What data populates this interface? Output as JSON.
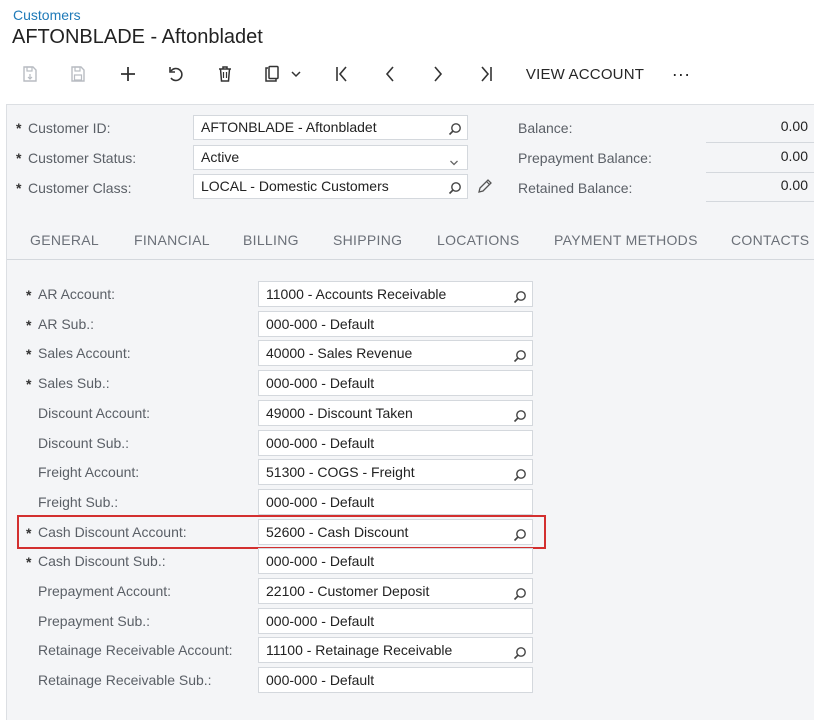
{
  "breadcrumb": "Customers",
  "title": "AFTONBLADE - Aftonbladet",
  "toolbar": {
    "view_account": "VIEW ACCOUNT",
    "more": "···"
  },
  "summary": {
    "customer_id": {
      "label": "Customer ID:",
      "value": "AFTONBLADE - Aftonbladet"
    },
    "customer_status": {
      "label": "Customer Status:",
      "value": "Active"
    },
    "customer_class": {
      "label": "Customer Class:",
      "value": "LOCAL - Domestic Customers"
    },
    "balance": {
      "label": "Balance:",
      "value": "0.00"
    },
    "prepayment_balance": {
      "label": "Prepayment Balance:",
      "value": "0.00"
    },
    "retained_balance": {
      "label": "Retained Balance:",
      "value": "0.00"
    }
  },
  "tabs": [
    "GENERAL",
    "FINANCIAL",
    "BILLING",
    "SHIPPING",
    "LOCATIONS",
    "PAYMENT METHODS",
    "CONTACTS"
  ],
  "accounts": [
    {
      "label": "AR Account:",
      "value": "11000 - Accounts Receivable",
      "required": "*",
      "lookup": true
    },
    {
      "label": "AR Sub.:",
      "value": "000-000 - Default",
      "required": "*",
      "lookup": false
    },
    {
      "label": "Sales Account:",
      "value": "40000 - Sales Revenue",
      "required": "*",
      "lookup": true
    },
    {
      "label": "Sales Sub.:",
      "value": "000-000 - Default",
      "required": "*",
      "lookup": false
    },
    {
      "label": "Discount Account:",
      "value": "49000 - Discount Taken",
      "required": "",
      "lookup": true
    },
    {
      "label": "Discount Sub.:",
      "value": "000-000 - Default",
      "required": "",
      "lookup": false
    },
    {
      "label": "Freight Account:",
      "value": "51300 - COGS - Freight",
      "required": "",
      "lookup": true
    },
    {
      "label": "Freight Sub.:",
      "value": "000-000 - Default",
      "required": "",
      "lookup": false
    },
    {
      "label": "Cash Discount Account:",
      "value": "52600 - Cash Discount",
      "required": "*",
      "lookup": true
    },
    {
      "label": "Cash Discount Sub.:",
      "value": "000-000 - Default",
      "required": "*",
      "lookup": false
    },
    {
      "label": "Prepayment Account:",
      "value": "22100 - Customer Deposit",
      "required": "",
      "lookup": true
    },
    {
      "label": "Prepayment Sub.:",
      "value": "000-000 - Default",
      "required": "",
      "lookup": false
    },
    {
      "label": "Retainage Receivable Account:",
      "value": "11100 - Retainage Receivable",
      "required": "",
      "lookup": true
    },
    {
      "label": "Retainage Receivable Sub.:",
      "value": "000-000 - Default",
      "required": "",
      "lookup": false
    }
  ],
  "colors": {
    "link": "#1f7ab8",
    "highlight": "#d32f2f",
    "panel": "#f4f5f7"
  }
}
